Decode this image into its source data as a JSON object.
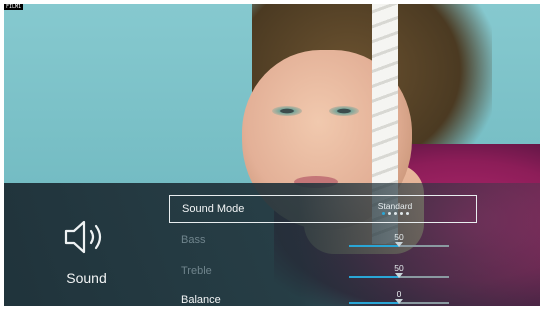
{
  "corner_tag": "FILM1",
  "panel": {
    "title": "Sound",
    "icon": "speaker-icon"
  },
  "menu": {
    "items": [
      {
        "label": "Sound Mode",
        "value": "Standard",
        "selected": true,
        "dots": 5,
        "active_dot": 0
      },
      {
        "label": "Bass",
        "value": "50",
        "level": 0.5,
        "dimmed": true
      },
      {
        "label": "Treble",
        "value": "50",
        "level": 0.5,
        "dimmed": true
      },
      {
        "label": "Balance",
        "value": "0",
        "level": 0.5,
        "dimmed": false
      }
    ]
  },
  "colors": {
    "accent": "#2aa6d6",
    "highlight_border": "#e9eef0"
  }
}
